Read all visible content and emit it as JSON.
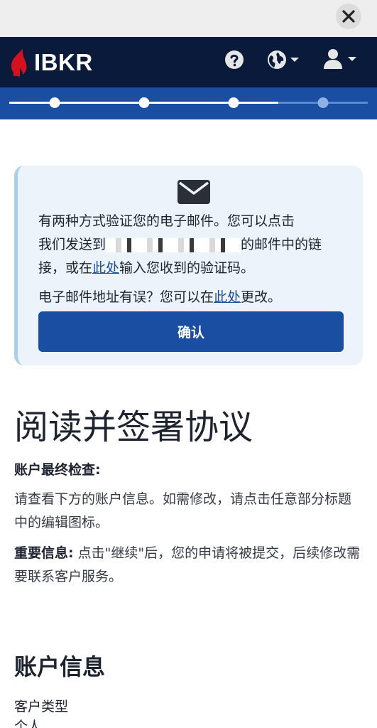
{
  "app": {
    "brand": "IBKR",
    "brand_color": "#0a1a3a",
    "accent": "#1a4ea3"
  },
  "window": {
    "close_icon": "close-icon"
  },
  "header": {
    "icons": [
      "help-icon",
      "globe-icon",
      "user-icon"
    ]
  },
  "progress": {
    "completed_steps": 3,
    "total_steps": 4
  },
  "verify": {
    "icon": "envelope-icon",
    "line1": "有两种方式验证您的电子邮件。您可以点击",
    "line2_pre": "我们发送到",
    "line2_post": "的邮件中的链",
    "line3_pre": "接，或在",
    "line3_link": "此处",
    "line3_post": "输入您收到的验证码。",
    "change_pre": "电子邮件地址有误？您可以在",
    "change_link": "此处",
    "change_post": "更改。",
    "confirm_label": "确认"
  },
  "main": {
    "title": "阅读并签署协议",
    "final_check_label": "账户最终检查:",
    "final_check_text": "请查看下方的账户信息。如需修改，请点击任意部分标题中的编辑图标。",
    "important_label": "重要信息:",
    "important_text": " 点击\"继续\"后，您的申请将被提交，后续修改需要联系客户服务。",
    "account_info_title": "账户信息",
    "account_type_label": "客户类型",
    "account_type_value": "个人"
  }
}
